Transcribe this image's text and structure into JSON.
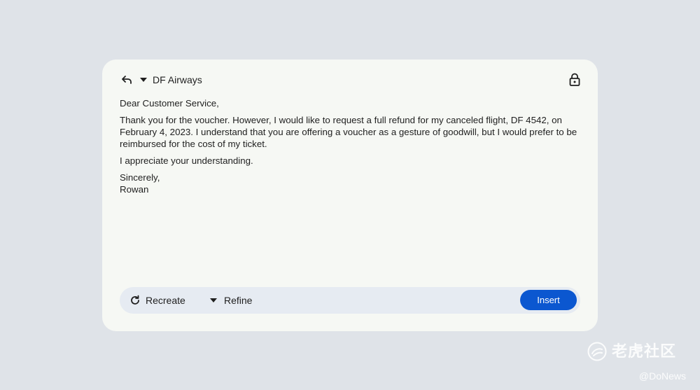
{
  "header": {
    "recipient": "DF Airways",
    "icons": {
      "reply": "reply-icon",
      "dropdown": "dropdown-arrow-icon",
      "lock": "lock-icon"
    }
  },
  "message": {
    "greeting": "Dear Customer Service,",
    "paragraph1": "Thank you for the voucher. However, I would like to request a full refund for my canceled flight, DF 4542, on February 4, 2023. I understand that you are offering a voucher as a gesture of goodwill, but I would prefer to be reimbursed for the cost of my ticket.",
    "paragraph2": "I appreciate your understanding.",
    "closing": "Sincerely,",
    "signature": "Rowan"
  },
  "actions": {
    "recreate_label": "Recreate",
    "refine_label": "Refine",
    "insert_label": "Insert"
  },
  "watermark": {
    "brand": "老虎社区",
    "handle": "@DoNews"
  },
  "colors": {
    "background": "#dfe3e8",
    "card": "#f6f8f4",
    "action_bar": "#e6ebf2",
    "primary": "#0b57d0"
  }
}
